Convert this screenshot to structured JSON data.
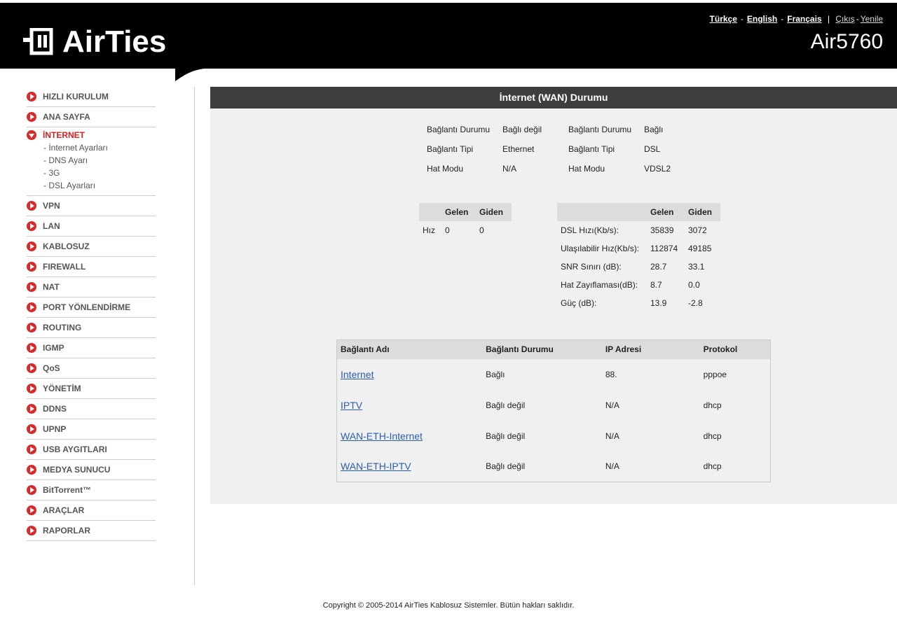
{
  "header": {
    "brand": "AirTies",
    "model": "Air5760",
    "languages": [
      "Türkçe",
      "English",
      "Français"
    ],
    "logout": "Çıkış",
    "refresh": "Yenile"
  },
  "sidebar": {
    "items": [
      {
        "label": "HIZLI KURULUM"
      },
      {
        "label": "ANA SAYFA"
      },
      {
        "label": "İNTERNET",
        "active": true,
        "sub": [
          "- İnternet Ayarları",
          "- DNS Ayarı",
          "- 3G",
          "- DSL Ayarları"
        ]
      },
      {
        "label": "VPN"
      },
      {
        "label": "LAN"
      },
      {
        "label": "KABLOSUZ"
      },
      {
        "label": "FIREWALL"
      },
      {
        "label": "NAT"
      },
      {
        "label": "PORT YÖNLENDİRME"
      },
      {
        "label": "ROUTING"
      },
      {
        "label": "IGMP"
      },
      {
        "label": "QoS"
      },
      {
        "label": "YÖNETİM"
      },
      {
        "label": "DDNS"
      },
      {
        "label": "UPNP"
      },
      {
        "label": "USB AYGITLARI"
      },
      {
        "label": "MEDYA SUNUCU"
      },
      {
        "label": "BitTorrent™"
      },
      {
        "label": "ARAÇLAR"
      },
      {
        "label": "RAPORLAR"
      }
    ]
  },
  "main": {
    "title": "İnternet (WAN) Durumu",
    "eth_status": {
      "rows": [
        {
          "label": "Bağlantı Durumu",
          "value": "Bağlı değil"
        },
        {
          "label": "Bağlantı Tipi",
          "value": "Ethernet"
        },
        {
          "label": "Hat Modu",
          "value": "N/A"
        }
      ]
    },
    "dsl_status": {
      "rows": [
        {
          "label": "Bağlantı Durumu",
          "value": "Bağlı"
        },
        {
          "label": "Bağlantı Tipi",
          "value": "DSL"
        },
        {
          "label": "Hat Modu",
          "value": "VDSL2"
        }
      ]
    },
    "eth_speed": {
      "headers": [
        "",
        "Gelen",
        "Giden"
      ],
      "rows": [
        [
          "Hız",
          "0",
          "0"
        ]
      ]
    },
    "dsl_speed": {
      "headers": [
        "",
        "Gelen",
        "Giden"
      ],
      "rows": [
        [
          "DSL Hızı(Kb/s):",
          "35839",
          "3072"
        ],
        [
          "Ulaşılabilir Hız(Kb/s):",
          "112874",
          "49185"
        ],
        [
          "SNR Sınırı (dB):",
          "28.7",
          "33.1"
        ],
        [
          "Hat Zayıflaması(dB):",
          "8.7",
          "0.0"
        ],
        [
          "Güç (dB):",
          "13.9",
          "-2.8"
        ]
      ]
    },
    "connections": {
      "headers": [
        "Bağlantı Adı",
        "Bağlantı Durumu",
        "IP Adresi",
        "Protokol"
      ],
      "rows": [
        [
          "Internet",
          "Bağlı",
          "88.",
          "pppoe"
        ],
        [
          "IPTV",
          "Bağlı değil",
          "N/A",
          "dhcp"
        ],
        [
          "WAN-ETH-Internet",
          "Bağlı değil",
          "N/A",
          "dhcp"
        ],
        [
          "WAN-ETH-IPTV",
          "Bağlı değil",
          "N/A",
          "dhcp"
        ]
      ]
    }
  },
  "footer": "Copyright © 2005-2014 AirTies Kablosuz Sistemler. Bütün hakları saklıdır."
}
